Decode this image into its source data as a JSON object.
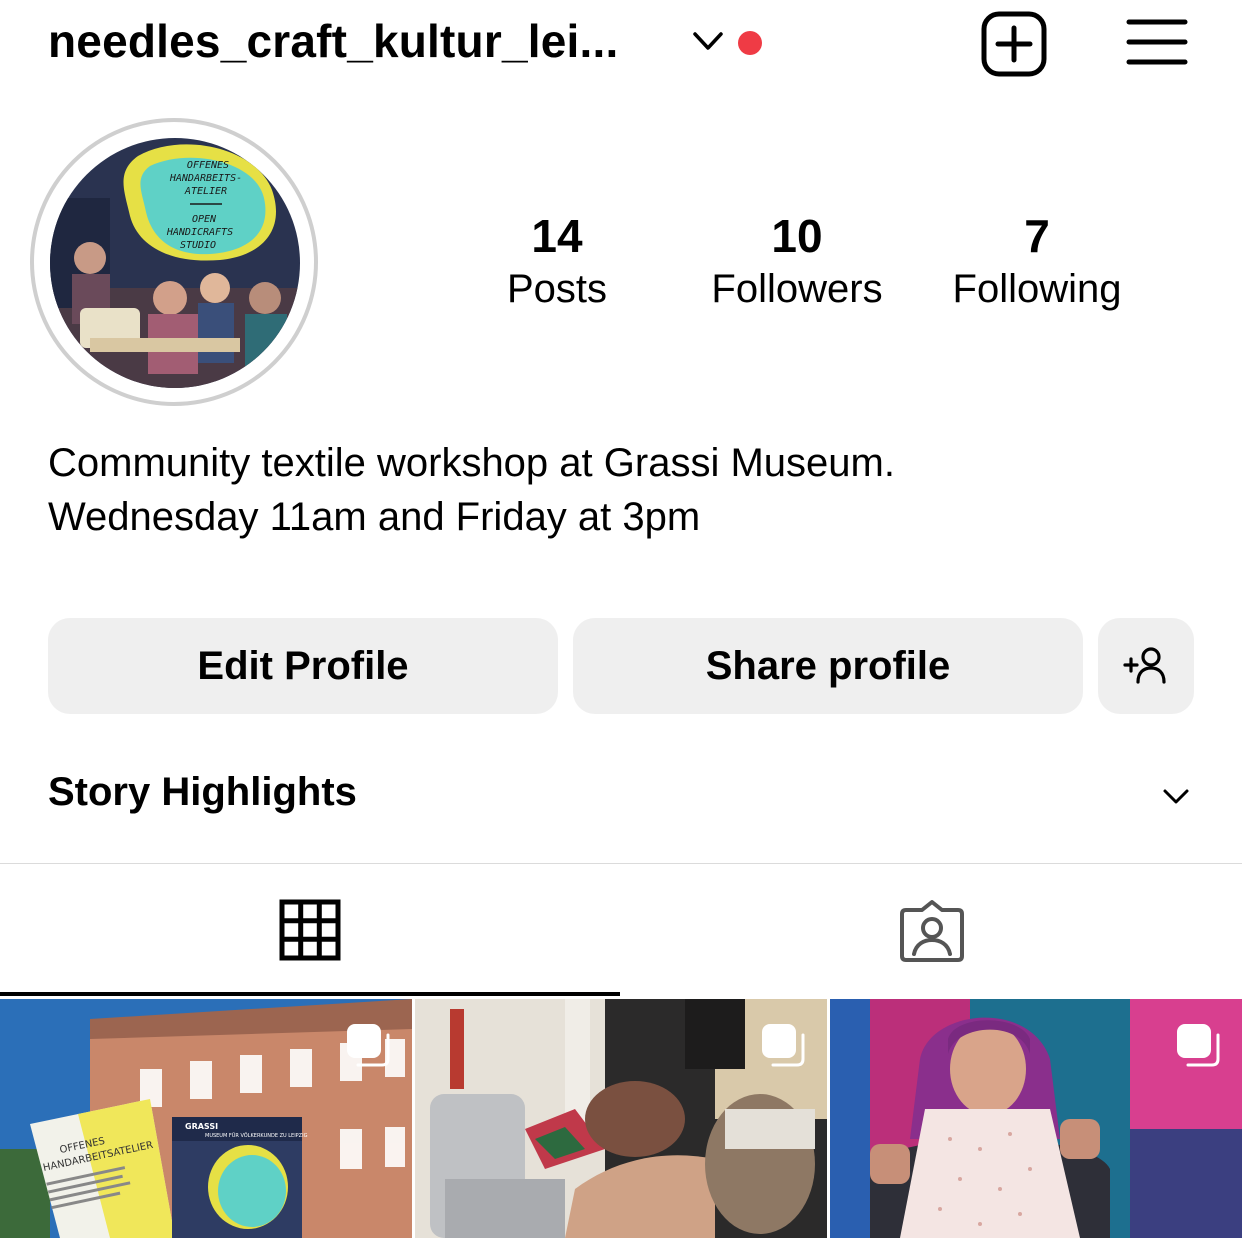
{
  "header": {
    "username": "needles_craft_kultur_lei...",
    "icons": {
      "account_switch": "chevron-down-icon",
      "new_post": "plus-square-icon",
      "menu": "hamburger-menu-icon"
    },
    "notification_dot_color": "#ef3b45"
  },
  "profile": {
    "avatar_text": {
      "de": [
        "OFFENES",
        "HANDARBEITS-",
        "ATELIER"
      ],
      "en": [
        "OPEN",
        "HANDICRAFTS",
        "STUDIO"
      ]
    },
    "stats": [
      {
        "value": "14",
        "label": "Posts"
      },
      {
        "value": "10",
        "label": "Followers"
      },
      {
        "value": "7",
        "label": "Following"
      }
    ],
    "bio": [
      "Community textile workshop at Grassi Museum.",
      "Wednesday 11am and Friday at 3pm"
    ]
  },
  "actions": {
    "edit_profile": "Edit Profile",
    "share_profile": "Share profile",
    "add_person_icon": "add-person-icon"
  },
  "highlights": {
    "title": "Story Highlights"
  },
  "tabs": [
    {
      "icon": "grid-icon",
      "active": true
    },
    {
      "icon": "tagged-person-icon",
      "active": false
    }
  ],
  "posts": [
    {
      "type": "carousel",
      "scene": "museum-building-with-flyers",
      "texts": [
        "OFFENES",
        "HANDARBEITSATELIER",
        "GRASSI",
        "MUSEUM FÜR VÖLKERKUNDE ZU LEIPZIG"
      ]
    },
    {
      "type": "carousel",
      "scene": "sewing-machine-workshop"
    },
    {
      "type": "carousel",
      "scene": "woman-holding-baby-dress"
    }
  ],
  "colors": {
    "button_bg": "#efefef",
    "divider": "#dbdbdb",
    "avatar_ring": "#cfcfcf",
    "badge_teal": "#5fd1c6",
    "badge_yellow": "#e6e045"
  }
}
